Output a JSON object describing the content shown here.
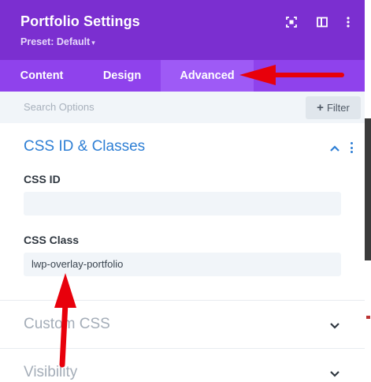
{
  "header": {
    "title": "Portfolio Settings",
    "preset_label": "Preset: Default",
    "preset_caret": "▾",
    "icons": [
      "focus-icon",
      "split-view-icon",
      "more-vertical-icon"
    ]
  },
  "tabs": [
    {
      "label": "Content",
      "active": false
    },
    {
      "label": "Design",
      "active": false
    },
    {
      "label": "Advanced",
      "active": true
    }
  ],
  "search": {
    "placeholder": "Search Options",
    "filter_plus": "+",
    "filter_label": "Filter"
  },
  "sections": {
    "css_id_classes": {
      "title": "CSS ID & Classes",
      "expanded": true,
      "fields": {
        "css_id": {
          "label": "CSS ID",
          "value": ""
        },
        "css_class": {
          "label": "CSS Class",
          "value": "lwp-overlay-portfolio"
        }
      }
    },
    "custom_css": {
      "title": "Custom CSS",
      "expanded": false
    },
    "visibility": {
      "title": "Visibility",
      "expanded": false
    }
  },
  "annotations": {
    "arrow_color": "#e8000b"
  },
  "colors": {
    "header_bg": "#7b2fd0",
    "tabs_bg": "#8f42ec",
    "active_tab_bg": "#9e5af6",
    "accent": "#2e7fd5"
  }
}
